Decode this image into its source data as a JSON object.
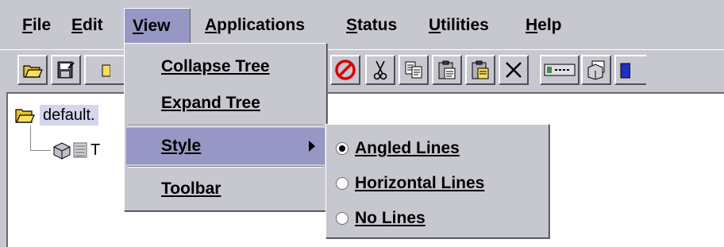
{
  "menubar": {
    "items": [
      {
        "mnemonic": "F",
        "rest": "ile"
      },
      {
        "mnemonic": "E",
        "rest": "dit"
      },
      {
        "mnemonic": "V",
        "rest": "iew"
      },
      {
        "mnemonic": "A",
        "rest": "pplications"
      },
      {
        "mnemonic": "S",
        "rest": "tatus"
      },
      {
        "mnemonic": "U",
        "rest": "tilities"
      },
      {
        "mnemonic": "H",
        "rest": "elp"
      }
    ],
    "open_menu": "View"
  },
  "toolbar": {
    "buttons": [
      "open-folder-icon",
      "save-icon",
      "stop-icon",
      "cut-icon",
      "copy-icon",
      "paste-icon",
      "paste-special-icon",
      "delete-icon",
      "device-icon",
      "properties-icon"
    ]
  },
  "tree": {
    "root_label": "default.",
    "child_label": "T"
  },
  "view_menu": {
    "items": [
      "Collapse Tree",
      "Expand Tree",
      "Style",
      "Toolbar"
    ],
    "selected": "Style"
  },
  "style_submenu": {
    "items": [
      "Angled Lines",
      "Horizontal Lines",
      "No Lines"
    ],
    "checked": "Angled Lines"
  },
  "colors": {
    "background": "#c7c7cf",
    "selection": "#9797c6",
    "tree_selection": "#d5d5ee"
  }
}
